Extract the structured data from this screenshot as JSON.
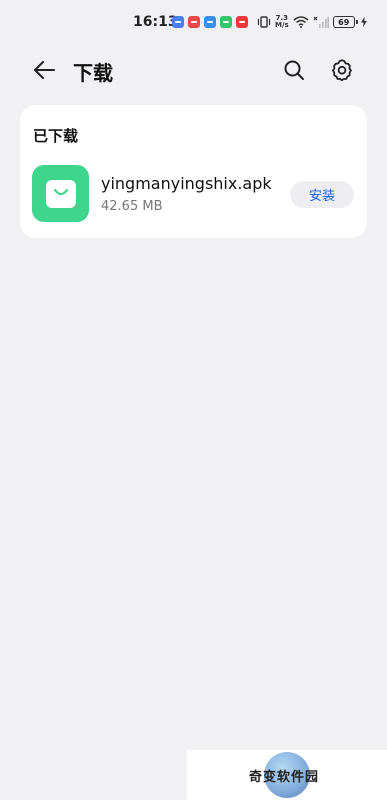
{
  "status_bar": {
    "time": "16:13",
    "net_speed_value": "7.3",
    "net_speed_unit": "M/s",
    "battery": "69",
    "notification_colors": [
      "#4a7ee8",
      "#e84a4a",
      "#3a8ee8",
      "#34c46a",
      "#e83a3a"
    ]
  },
  "header": {
    "title": "下载",
    "back_icon": "back-arrow-icon",
    "search_icon": "search-icon",
    "settings_icon": "gear-icon"
  },
  "downloads": {
    "section_title": "已下载",
    "items": [
      {
        "name": "yingmanyingshix.apk",
        "size": "42.65 MB",
        "action_label": "安装",
        "icon": "shopping-bag-icon",
        "icon_color": "#3dd68c"
      }
    ]
  },
  "watermark": {
    "text": "奇变软件园"
  },
  "colors": {
    "background": "#f1f1f3",
    "card": "#ffffff",
    "accent": "#1a5fd6"
  }
}
